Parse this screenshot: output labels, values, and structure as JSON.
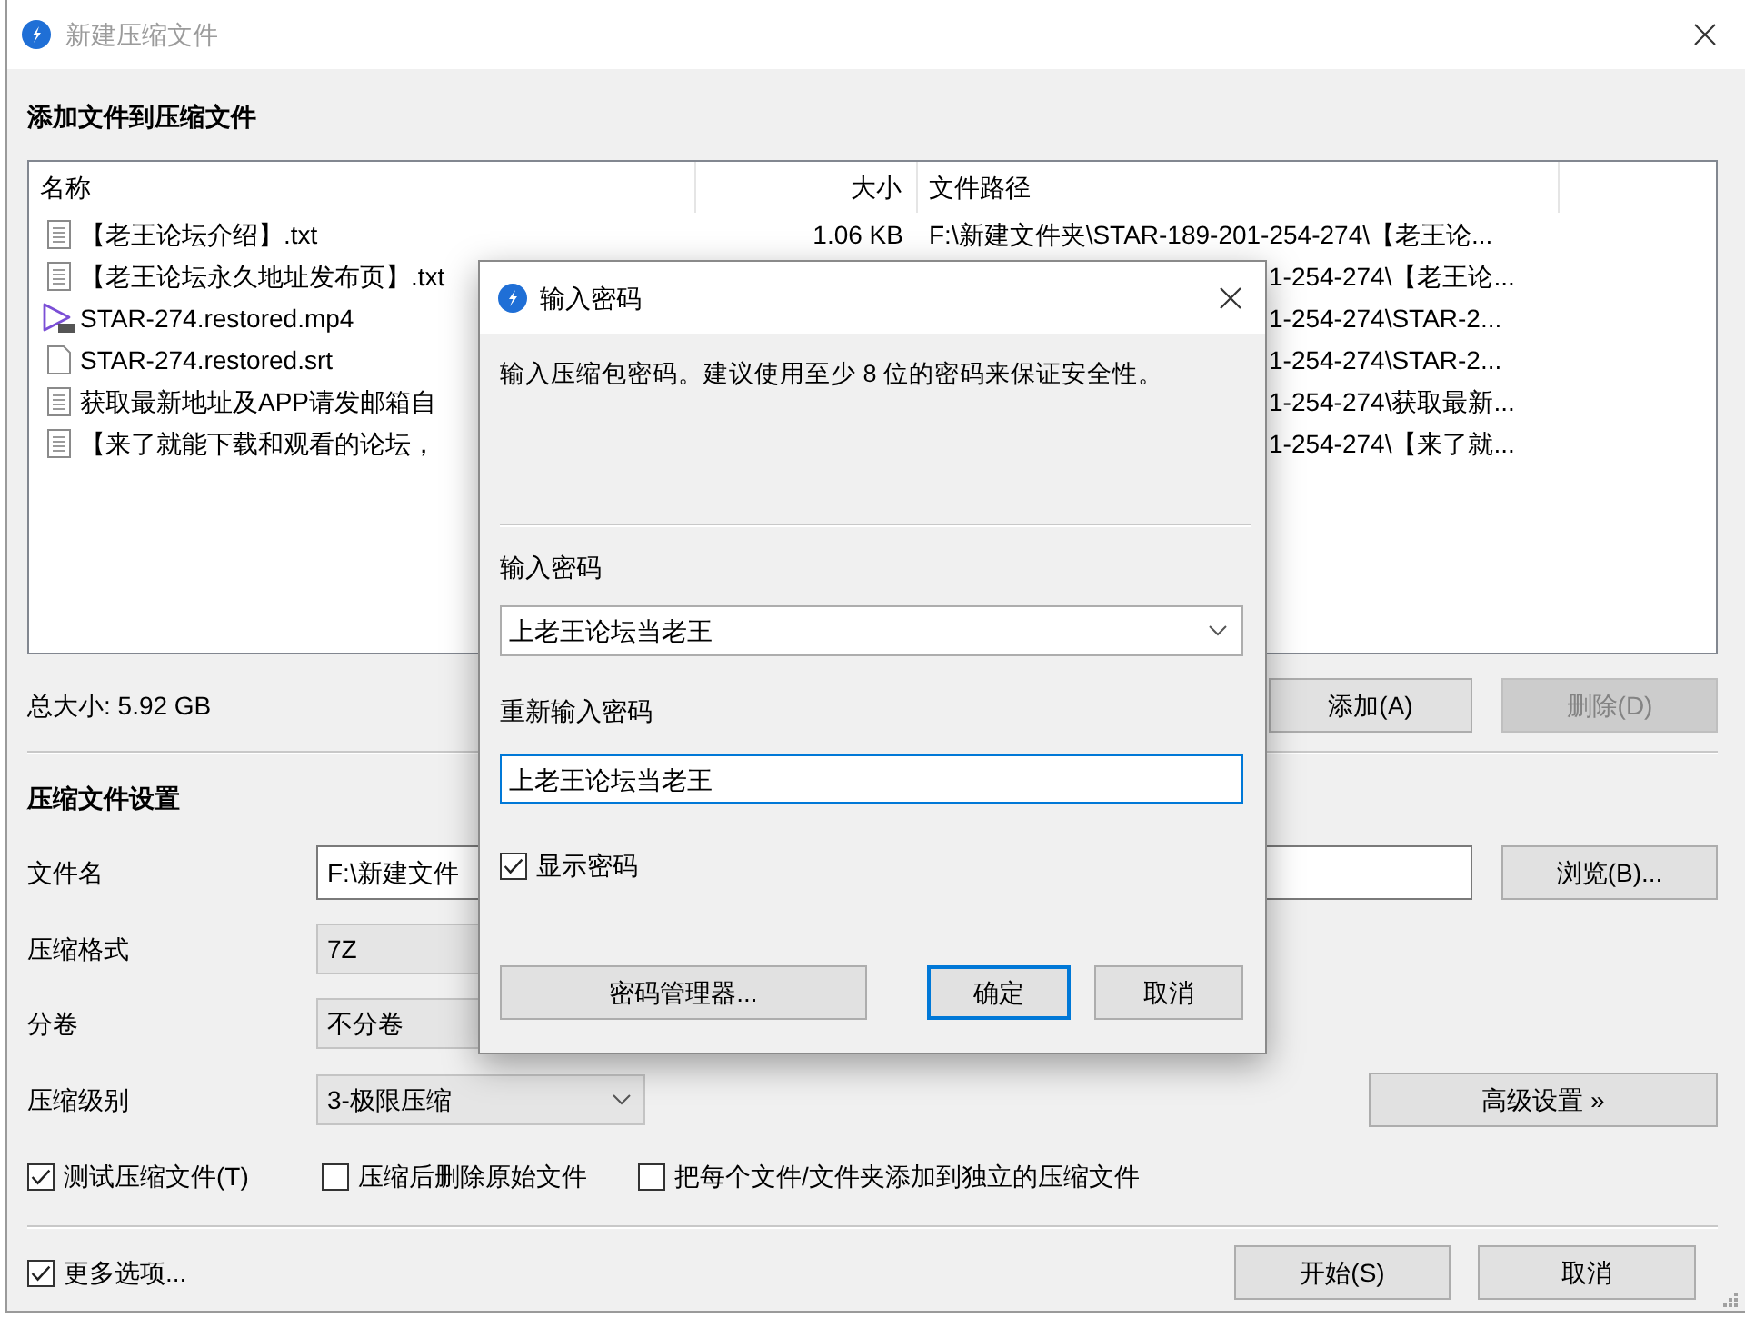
{
  "window": {
    "title": "新建压缩文件"
  },
  "files_section": {
    "heading": "添加文件到压缩文件",
    "columns": [
      "名称",
      "大小",
      "文件路径"
    ],
    "rows": [
      {
        "kind": "text",
        "name": "【老王论坛介绍】.txt",
        "size": "1.06 KB",
        "path": "F:\\新建文件夹\\STAR-189-201-254-274\\【老王论..."
      },
      {
        "kind": "text",
        "name": "【老王论坛永久地址发布页】.txt",
        "path": "1-254-274\\【老王论..."
      },
      {
        "kind": "video",
        "name": "STAR-274.restored.mp4",
        "path": "1-254-274\\STAR-2..."
      },
      {
        "kind": "blank",
        "name": "STAR-274.restored.srt",
        "path": "1-254-274\\STAR-2..."
      },
      {
        "kind": "text",
        "name": "获取最新地址及APP请发邮箱自",
        "path": "1-254-274\\获取最新..."
      },
      {
        "kind": "text",
        "name": "【来了就能下载和观看的论坛，",
        "path": "1-254-274\\【来了就..."
      }
    ],
    "total_size": "总大小: 5.92 GB",
    "buttons": [
      {
        "label": "添加(A)",
        "disabled": false
      },
      {
        "label": "删除(D)",
        "disabled": true
      }
    ]
  },
  "settings": {
    "heading": "压缩文件设置",
    "fields": [
      {
        "kind": "input",
        "label": "文件名",
        "value": "F:\\新建文件",
        "button": "浏览(B)..."
      },
      {
        "kind": "select",
        "label": "压缩格式",
        "value": "7Z"
      },
      {
        "kind": "select",
        "label": "分卷",
        "value": "不分卷"
      },
      {
        "kind": "select",
        "label": "压缩级别",
        "value": "3-极限压缩",
        "button": "高级设置 »"
      }
    ],
    "options": [
      {
        "label": "测试压缩文件(T)",
        "checked": true
      },
      {
        "label": "压缩后删除原始文件",
        "checked": false
      },
      {
        "label": "把每个文件/文件夹添加到独立的压缩文件",
        "checked": false
      }
    ]
  },
  "footer": {
    "more_options": {
      "label": "更多选项...",
      "checked": true
    },
    "buttons": [
      {
        "label": "开始(S)"
      },
      {
        "label": "取消"
      }
    ]
  },
  "password_dialog": {
    "title": "输入密码",
    "message": "输入压缩包密码。建议使用至少 8 位的密码来保证安全性。",
    "fields": [
      {
        "kind": "combo",
        "label": "输入密码",
        "value": "上老王论坛当老王",
        "focused": false
      },
      {
        "kind": "input",
        "label": "重新输入密码",
        "value": "上老王论坛当老王",
        "focused": true
      }
    ],
    "show_password": {
      "label": "显示密码",
      "checked": true
    },
    "buttons": [
      {
        "label": "密码管理器...",
        "default": false
      },
      {
        "label": "确定",
        "default": true
      },
      {
        "label": "取消",
        "default": false
      }
    ]
  }
}
